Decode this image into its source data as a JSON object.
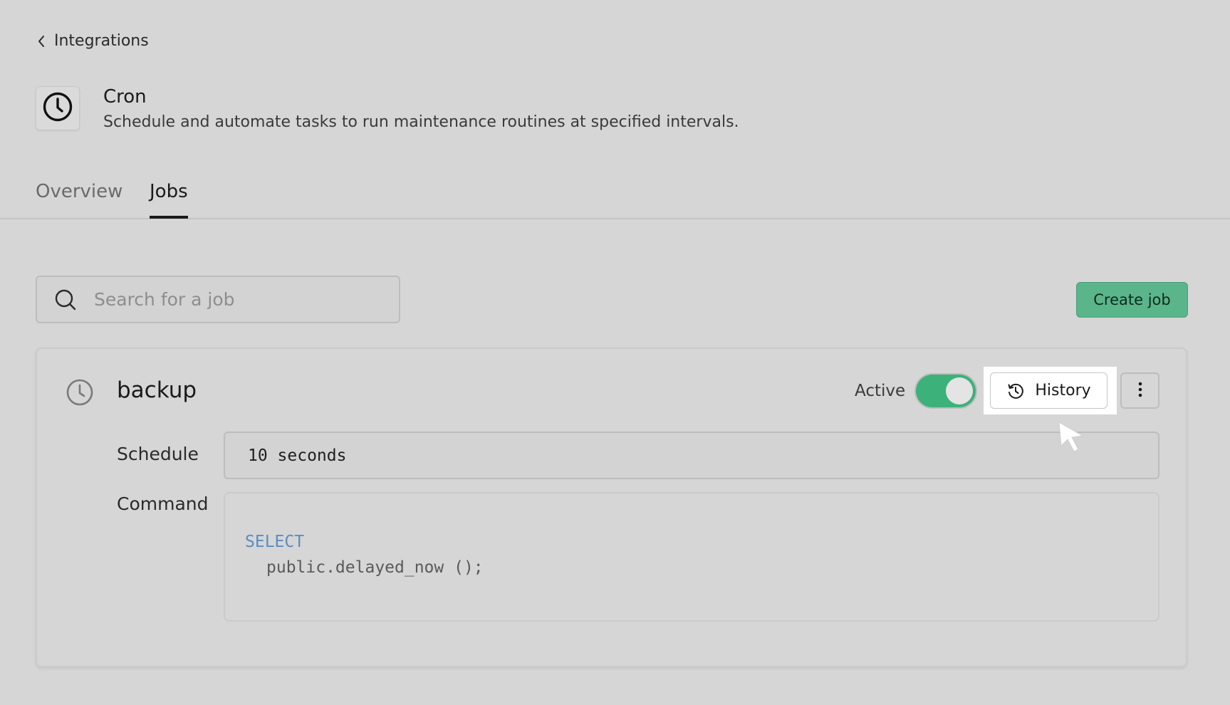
{
  "breadcrumb": {
    "back_label": "Integrations"
  },
  "integration": {
    "title": "Cron",
    "description": "Schedule and automate tasks to run maintenance routines at specified intervals.",
    "icon": "clock-icon"
  },
  "tabs": [
    {
      "label": "Overview",
      "active": false
    },
    {
      "label": "Jobs",
      "active": true
    }
  ],
  "search": {
    "placeholder": "Search for a job",
    "value": ""
  },
  "toolbar": {
    "create_label": "Create job"
  },
  "job": {
    "name": "backup",
    "status_label": "Active",
    "active": true,
    "history_label": "History",
    "schedule_label": "Schedule",
    "schedule_value": "10 seconds",
    "command_label": "Command",
    "command_keyword": "SELECT",
    "command_body": "public.delayed_now ();"
  },
  "colors": {
    "background": "#d6d6d6",
    "accent_green": "#3cb27a",
    "create_button": "#5ab58a",
    "sql_keyword": "#5a8dc0"
  }
}
